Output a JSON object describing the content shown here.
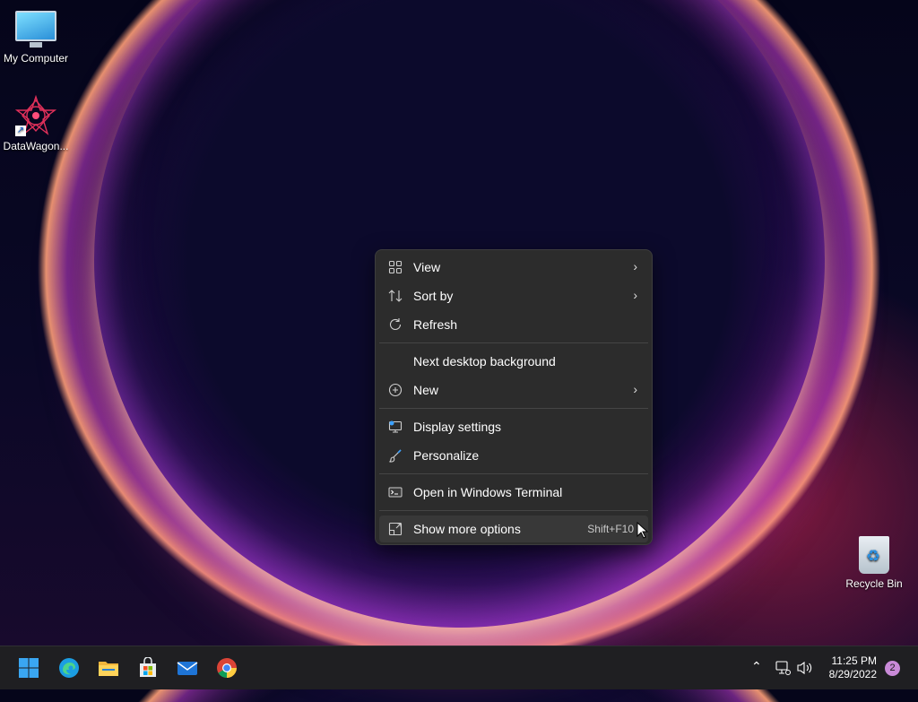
{
  "desktop": {
    "icons": [
      {
        "label": "My Computer",
        "icon": "computer-icon"
      },
      {
        "label": "DataWagon...",
        "icon": "datawagon-shortcut-icon"
      },
      {
        "label": "Recycle Bin",
        "icon": "recycle-bin-icon"
      }
    ]
  },
  "context_menu": {
    "items": [
      {
        "label": "View",
        "icon": "grid-view-icon",
        "has_submenu": true
      },
      {
        "label": "Sort by",
        "icon": "sort-icon",
        "has_submenu": true
      },
      {
        "label": "Refresh",
        "icon": "refresh-icon"
      },
      {
        "label": "Next desktop background",
        "icon": ""
      },
      {
        "label": "New",
        "icon": "plus-circle-icon",
        "has_submenu": true
      },
      {
        "label": "Display settings",
        "icon": "display-icon"
      },
      {
        "label": "Personalize",
        "icon": "brush-icon"
      },
      {
        "label": "Open in Windows Terminal",
        "icon": "terminal-icon"
      },
      {
        "label": "Show more options",
        "icon": "expand-icon",
        "shortcut": "Shift+F10"
      }
    ]
  },
  "taskbar": {
    "apps": [
      "start-icon",
      "edge-icon",
      "file-explorer-icon",
      "store-icon",
      "mail-icon",
      "chrome-icon"
    ],
    "time": "11:25 PM",
    "date": "8/29/2022",
    "notification_count": "2"
  },
  "colors": {
    "menu_bg": "#2c2c2c",
    "taskbar_bg": "#1f1f22",
    "accent": "#0078d4"
  }
}
